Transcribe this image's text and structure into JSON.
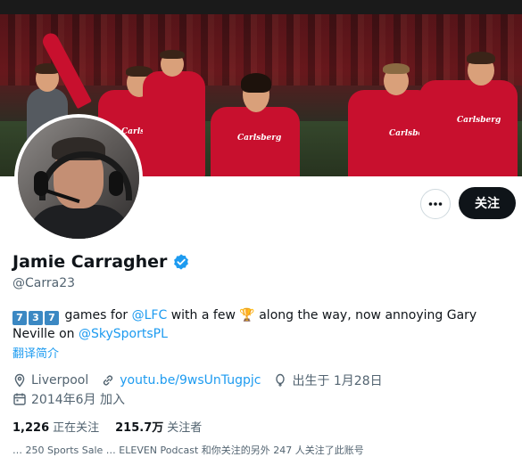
{
  "profile": {
    "display_name": "Jamie Carragher",
    "handle": "@Carra23",
    "verified_icon": "verified-badge-icon",
    "banner_sponsor_text": "Carlsberg"
  },
  "actions": {
    "more_label": "More",
    "follow_label": "关注"
  },
  "bio": {
    "keycaps": [
      "7",
      "3",
      "7"
    ],
    "text_1": " games for ",
    "mention_1": "@LFC",
    "text_2": " with a few ",
    "trophy_icon": "🏆",
    "text_3": " along the way, now annoying Gary Neville on ",
    "mention_2": "@SkySportsPL"
  },
  "translate_label": "翻译简介",
  "meta": {
    "location": "Liverpool",
    "website": "youtu.be/9wsUnTugpjc",
    "birthday": "出生于 1月28日",
    "joined": "2014年6月 加入"
  },
  "stats": {
    "following_count": "1,226",
    "following_label": "正在关注",
    "followers_count": "215.7万",
    "followers_label": "关注者"
  },
  "bottom_text": "… 250 Sports Sale … ELEVEN Podcast 和你关注的另外 247 人关注了此账号"
}
